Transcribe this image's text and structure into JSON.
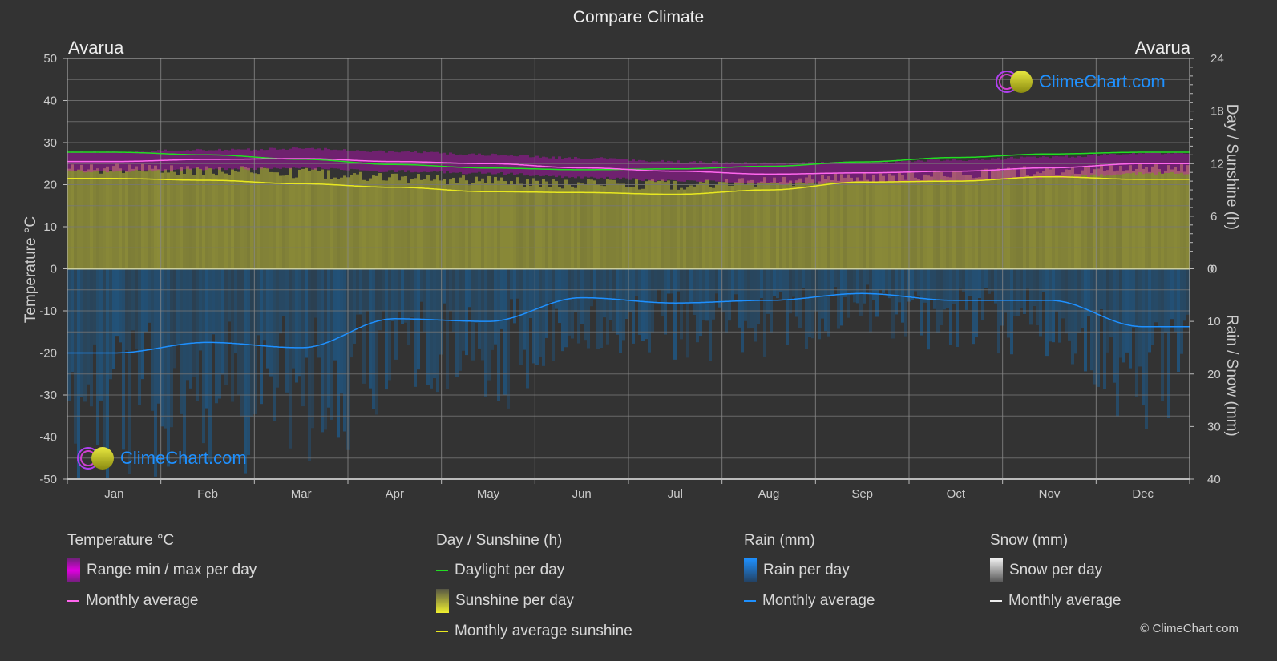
{
  "title": "Compare Climate",
  "location_left": "Avarua",
  "location_right": "Avarua",
  "watermark": "ClimeChart.com",
  "copyright": "© ClimeChart.com",
  "colors": {
    "background": "#333333",
    "temp_range": "#e000e0",
    "temp_avg": "#ff66ee",
    "daylight": "#22dd22",
    "sunshine_fill": "#8b8b38",
    "sunshine_avg": "#e8e820",
    "rain_fill": "#1e5a8a",
    "rain_avg": "#1e90ff",
    "snow_avg": "#ffffff"
  },
  "legend": {
    "groups": [
      {
        "title": "Temperature °C",
        "items": [
          {
            "label": "Range min / max per day",
            "kind": "box",
            "icon": "temp-range-swatch"
          },
          {
            "label": "Monthly average",
            "kind": "line",
            "icon": "temp-avg-swatch"
          }
        ]
      },
      {
        "title": "Day / Sunshine (h)",
        "items": [
          {
            "label": "Daylight per day",
            "kind": "line",
            "icon": "daylight-swatch"
          },
          {
            "label": "Sunshine per day",
            "kind": "box",
            "icon": "sunshine-swatch"
          },
          {
            "label": "Monthly average sunshine",
            "kind": "line",
            "icon": "sunshine-avg-swatch"
          }
        ]
      },
      {
        "title": "Rain (mm)",
        "items": [
          {
            "label": "Rain per day",
            "kind": "box",
            "icon": "rain-swatch"
          },
          {
            "label": "Monthly average",
            "kind": "line",
            "icon": "rain-avg-swatch"
          }
        ]
      },
      {
        "title": "Snow (mm)",
        "items": [
          {
            "label": "Snow per day",
            "kind": "box",
            "icon": "snow-swatch"
          },
          {
            "label": "Monthly average",
            "kind": "line",
            "icon": "snow-avg-swatch"
          }
        ]
      }
    ]
  },
  "chart_data": {
    "type": "line",
    "title": "Compare Climate",
    "categories": [
      "Jan",
      "Feb",
      "Mar",
      "Apr",
      "May",
      "Jun",
      "Jul",
      "Aug",
      "Sep",
      "Oct",
      "Nov",
      "Dec"
    ],
    "axes": {
      "left": {
        "label": "Temperature °C",
        "range": [
          -50,
          50
        ],
        "ticks": [
          50,
          40,
          30,
          20,
          10,
          0,
          -10,
          -20,
          -30,
          -40,
          -50
        ]
      },
      "right_top": {
        "label": "Day / Sunshine (h)",
        "range": [
          0,
          24
        ],
        "ticks": [
          24,
          18,
          12,
          6,
          0
        ]
      },
      "right_bottom": {
        "label": "Rain / Snow (mm)",
        "range": [
          0,
          40
        ],
        "ticks": [
          0,
          10,
          20,
          30,
          40
        ],
        "inverted": true
      }
    },
    "grid": true,
    "series": [
      {
        "name": "Temperature monthly average",
        "unit": "°C",
        "axis": "left",
        "values": [
          25.5,
          26.0,
          26.2,
          25.5,
          25.0,
          24.0,
          23.2,
          22.5,
          22.8,
          23.2,
          24.0,
          25.0
        ]
      },
      {
        "name": "Temperature range max (approx)",
        "unit": "°C",
        "axis": "left",
        "values": [
          27.5,
          28.0,
          28.3,
          27.5,
          26.8,
          26.0,
          25.2,
          24.7,
          25.0,
          25.5,
          26.3,
          27.2
        ]
      },
      {
        "name": "Temperature range min (approx)",
        "unit": "°C",
        "axis": "left",
        "values": [
          23.5,
          24.0,
          24.2,
          23.5,
          23.0,
          22.0,
          21.2,
          20.5,
          20.8,
          21.2,
          22.0,
          23.0
        ]
      },
      {
        "name": "Daylight per day",
        "unit": "h",
        "axis": "right_top",
        "values": [
          13.3,
          13.0,
          12.5,
          11.9,
          11.5,
          11.3,
          11.4,
          11.7,
          12.2,
          12.7,
          13.1,
          13.3
        ]
      },
      {
        "name": "Sunshine per day",
        "unit": "h",
        "axis": "right_top",
        "values": [
          12.0,
          11.8,
          11.5,
          11.0,
          10.6,
          10.3,
          10.2,
          10.6,
          11.0,
          11.3,
          11.8,
          12.0
        ]
      },
      {
        "name": "Monthly average sunshine",
        "unit": "h",
        "axis": "right_top",
        "values": [
          10.3,
          10.1,
          9.7,
          9.3,
          8.8,
          8.7,
          8.5,
          9.0,
          9.9,
          10.0,
          10.5,
          10.2
        ]
      },
      {
        "name": "Rain monthly average",
        "unit": "mm",
        "axis": "right_bottom",
        "values": [
          16.0,
          14.0,
          15.0,
          9.5,
          10.0,
          5.5,
          6.5,
          6.0,
          4.7,
          6.0,
          6.0,
          11.0
        ]
      },
      {
        "name": "Snow monthly average",
        "unit": "mm",
        "axis": "right_bottom",
        "values": [
          0,
          0,
          0,
          0,
          0,
          0,
          0,
          0,
          0,
          0,
          0,
          0
        ]
      }
    ]
  }
}
